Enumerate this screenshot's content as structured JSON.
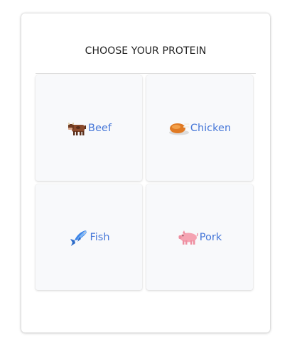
{
  "header": {
    "title": "CHOOSE YOUR PROTEIN"
  },
  "options": [
    {
      "label": "Beef",
      "icon": "cow-icon"
    },
    {
      "label": "Chicken",
      "icon": "roast-chicken-icon"
    },
    {
      "label": "Fish",
      "icon": "fish-icon"
    },
    {
      "label": "Pork",
      "icon": "pig-icon"
    }
  ],
  "colors": {
    "label": "#4677d8",
    "tile_background": "#f8f9fb",
    "card_background": "#ffffff"
  }
}
